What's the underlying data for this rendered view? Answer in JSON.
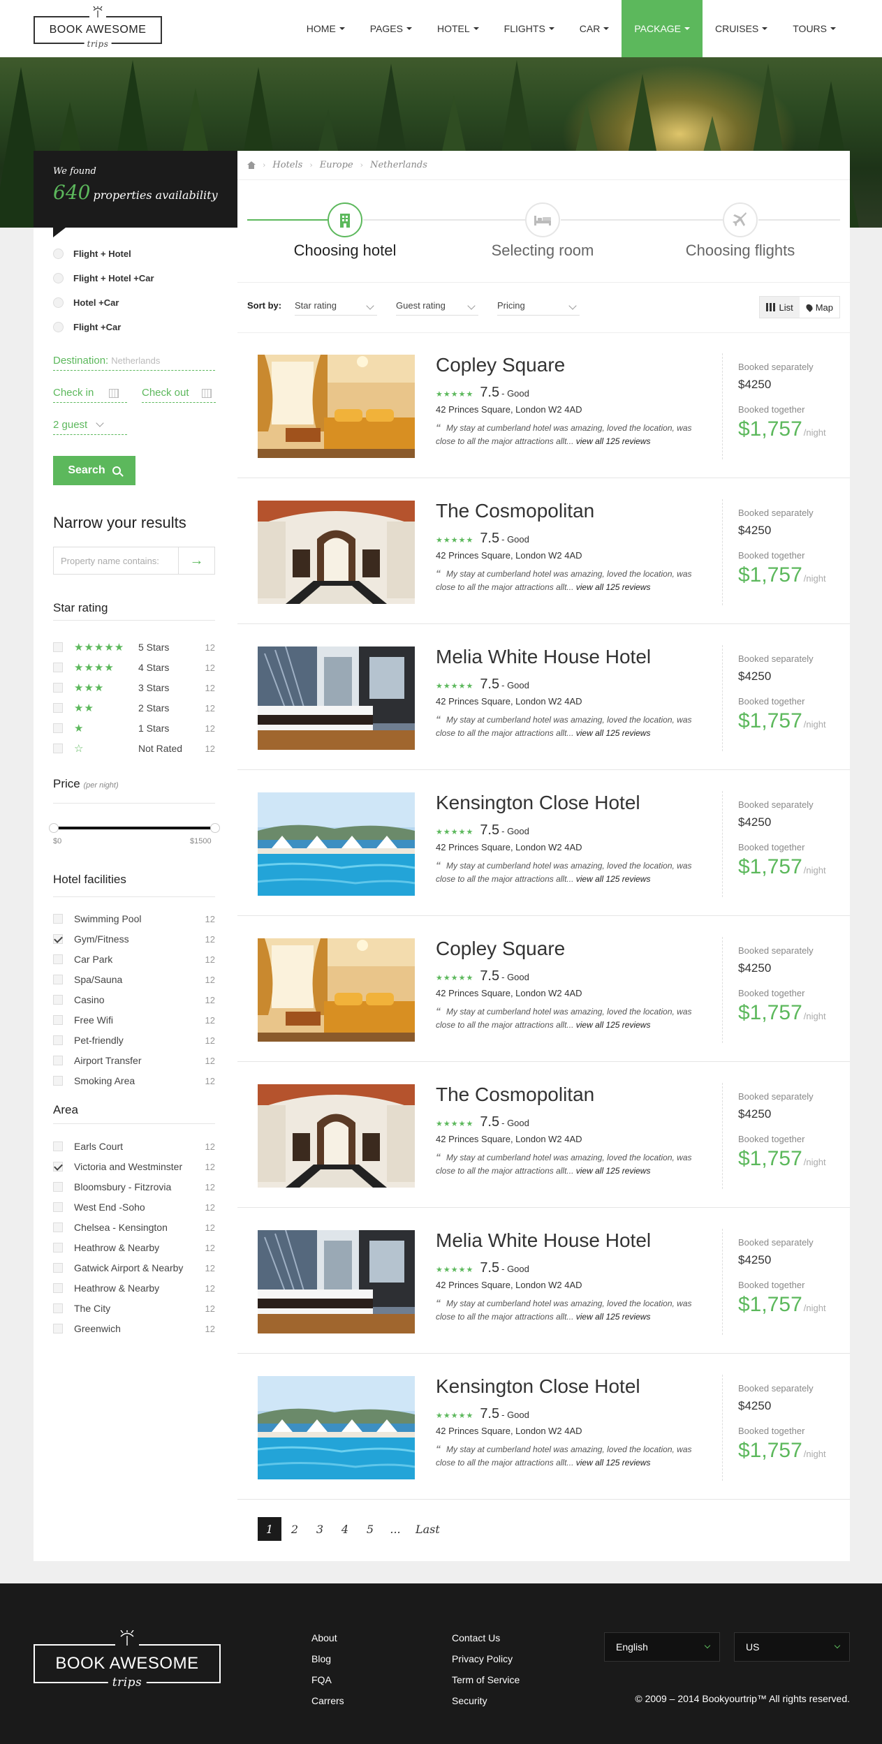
{
  "brand": {
    "logo_text": "BOOK AWESOME",
    "logo_script": "trips"
  },
  "nav": [
    {
      "label": "HOME",
      "active": false
    },
    {
      "label": "PAGES",
      "active": false
    },
    {
      "label": "HOTEL",
      "active": false
    },
    {
      "label": "FLIGHTS",
      "active": false
    },
    {
      "label": "CAR",
      "active": false
    },
    {
      "label": "PACKAGE",
      "active": true
    },
    {
      "label": "CRUISES",
      "active": false
    },
    {
      "label": "TOURS",
      "active": false
    }
  ],
  "colors": {
    "accent": "#5cb85c",
    "dark": "#1b1b1b"
  },
  "sidebar": {
    "found_label": "We found",
    "found_count": "640",
    "found_suffix": "properties availability",
    "trip_types": [
      "Flight + Hotel",
      "Flight + Hotel +Car",
      "Hotel +Car",
      "Flight +Car"
    ],
    "destination_label": "Destination:",
    "destination_placeholder": "Netherlands",
    "checkin_label": "Check in",
    "checkout_label": "Check out",
    "guests": "2 guest",
    "search_label": "Search",
    "narrow_title": "Narrow your results",
    "property_placeholder": "Property name contains:",
    "star_title": "Star rating",
    "stars": [
      {
        "stars": "★★★★★",
        "label": "5 Stars",
        "count": "12"
      },
      {
        "stars": "★★★★",
        "label": "4 Stars",
        "count": "12"
      },
      {
        "stars": "★★★",
        "label": "3 Stars",
        "count": "12"
      },
      {
        "stars": "★★",
        "label": "2 Stars",
        "count": "12"
      },
      {
        "stars": "★",
        "label": "1 Stars",
        "count": "12"
      },
      {
        "stars": "☆",
        "label": "Not Rated",
        "count": "12"
      }
    ],
    "price_title": "Price",
    "price_sub": "(per night)",
    "price_min": "$0",
    "price_max": "$1500",
    "facilities_title": "Hotel facilities",
    "facilities": [
      {
        "label": "Swimming Pool",
        "count": "12",
        "checked": false
      },
      {
        "label": "Gym/Fitness",
        "count": "12",
        "checked": true
      },
      {
        "label": "Car Park",
        "count": "12",
        "checked": false
      },
      {
        "label": "Spa/Sauna",
        "count": "12",
        "checked": false
      },
      {
        "label": "Casino",
        "count": "12",
        "checked": false
      },
      {
        "label": "Free Wifi",
        "count": "12",
        "checked": false
      },
      {
        "label": "Pet-friendly",
        "count": "12",
        "checked": false
      },
      {
        "label": "Airport Transfer",
        "count": "12",
        "checked": false
      },
      {
        "label": "Smoking Area",
        "count": "12",
        "checked": false
      }
    ],
    "area_title": "Area",
    "areas": [
      {
        "label": "Earls Court",
        "count": "12",
        "checked": false
      },
      {
        "label": "Victoria and Westminster",
        "count": "12",
        "checked": true
      },
      {
        "label": "Bloomsbury - Fitzrovia",
        "count": "12",
        "checked": false
      },
      {
        "label": "West End -Soho",
        "count": "12",
        "checked": false
      },
      {
        "label": "Chelsea - Kensington",
        "count": "12",
        "checked": false
      },
      {
        "label": "Heathrow & Nearby",
        "count": "12",
        "checked": false
      },
      {
        "label": "Gatwick Airport & Nearby",
        "count": "12",
        "checked": false
      },
      {
        "label": "Heathrow & Nearby",
        "count": "12",
        "checked": false
      },
      {
        "label": "The City",
        "count": "12",
        "checked": false
      },
      {
        "label": "Greenwich",
        "count": "12",
        "checked": false
      }
    ]
  },
  "breadcrumb": [
    "Hotels",
    "Europe",
    "Netherlands"
  ],
  "steps": [
    {
      "label": "Choosing hotel",
      "icon": "building-icon",
      "active": true
    },
    {
      "label": "Selecting room",
      "icon": "bed-icon",
      "active": false
    },
    {
      "label": "Choosing flights",
      "icon": "plane-icon",
      "active": false
    }
  ],
  "sort": {
    "label": "Sort by:",
    "options": [
      "Star rating",
      "Guest rating",
      "Pricing"
    ],
    "view_list": "List",
    "view_map": "Map"
  },
  "hotels": [
    {
      "name": "Copley Square",
      "stars": "★★★★★",
      "score": "7.5",
      "score_label": "- Good",
      "address": "42 Princes Square, London W2 4AD",
      "quote": "My stay at cumberland hotel was amazing, loved the location, was close to all the major attractions allt...",
      "reviews": "view all 125 reviews",
      "sep_label": "Booked separately",
      "sep_price": "$4250",
      "tog_label": "Booked together",
      "tog_price": "$1,757",
      "per": "/night",
      "image": "bedroom-gold"
    },
    {
      "name": "The Cosmopolitan",
      "stars": "★★★★★",
      "score": "7.5",
      "score_label": "- Good",
      "address": "42 Princes Square, London W2 4AD",
      "quote": "My stay at cumberland hotel was amazing, loved the location, was close to all the major attractions allt...",
      "reviews": "view all 125 reviews",
      "sep_label": "Booked separately",
      "sep_price": "$4250",
      "tog_label": "Booked together",
      "tog_price": "$1,757",
      "per": "/night",
      "image": "hallway-arch"
    },
    {
      "name": "Melia White House Hotel",
      "stars": "★★★★★",
      "score": "7.5",
      "score_label": "- Good",
      "address": "42 Princes Square, London W2 4AD",
      "quote": "My stay at cumberland hotel was amazing, loved the location, was close to all the major attractions allt...",
      "reviews": "view all 125 reviews",
      "sep_label": "Booked separately",
      "sep_price": "$4250",
      "tog_label": "Booked together",
      "tog_price": "$1,757",
      "per": "/night",
      "image": "bedroom-modern"
    },
    {
      "name": "Kensington Close Hotel",
      "stars": "★★★★★",
      "score": "7.5",
      "score_label": "- Good",
      "address": "42 Princes Square, London W2 4AD",
      "quote": "My stay at cumberland hotel was amazing, loved the location, was close to all the major attractions allt...",
      "reviews": "view all 125 reviews",
      "sep_label": "Booked separately",
      "sep_price": "$4250",
      "tog_label": "Booked together",
      "tog_price": "$1,757",
      "per": "/night",
      "image": "pool-sea"
    },
    {
      "name": "Copley Square",
      "stars": "★★★★★",
      "score": "7.5",
      "score_label": "- Good",
      "address": "42 Princes Square, London W2 4AD",
      "quote": "My stay at cumberland hotel was amazing, loved the location, was close to all the major attractions allt...",
      "reviews": "view all 125 reviews",
      "sep_label": "Booked separately",
      "sep_price": "$4250",
      "tog_label": "Booked together",
      "tog_price": "$1,757",
      "per": "/night",
      "image": "bedroom-gold"
    },
    {
      "name": "The Cosmopolitan",
      "stars": "★★★★★",
      "score": "7.5",
      "score_label": "- Good",
      "address": "42 Princes Square, London W2 4AD",
      "quote": "My stay at cumberland hotel was amazing, loved the location, was close to all the major attractions allt...",
      "reviews": "view all 125 reviews",
      "sep_label": "Booked separately",
      "sep_price": "$4250",
      "tog_label": "Booked together",
      "tog_price": "$1,757",
      "per": "/night",
      "image": "hallway-arch"
    },
    {
      "name": "Melia White House Hotel",
      "stars": "★★★★★",
      "score": "7.5",
      "score_label": "- Good",
      "address": "42 Princes Square, London W2 4AD",
      "quote": "My stay at cumberland hotel was amazing, loved the location, was close to all the major attractions allt...",
      "reviews": "view all 125 reviews",
      "sep_label": "Booked separately",
      "sep_price": "$4250",
      "tog_label": "Booked together",
      "tog_price": "$1,757",
      "per": "/night",
      "image": "bedroom-modern"
    },
    {
      "name": "Kensington Close Hotel",
      "stars": "★★★★★",
      "score": "7.5",
      "score_label": "- Good",
      "address": "42 Princes Square, London W2 4AD",
      "quote": "My stay at cumberland hotel was amazing, loved the location, was close to all the major attractions allt...",
      "reviews": "view all 125 reviews",
      "sep_label": "Booked separately",
      "sep_price": "$4250",
      "tog_label": "Booked together",
      "tog_price": "$1,757",
      "per": "/night",
      "image": "pool-sea"
    }
  ],
  "pagination": {
    "pages": [
      "1",
      "2",
      "3",
      "4",
      "5",
      "..."
    ],
    "current": "1",
    "last": "Last"
  },
  "footer": {
    "col1": [
      "About",
      "Blog",
      "FQA",
      "Carrers"
    ],
    "col2": [
      "Contact Us",
      "Privacy Policy",
      "Term of Service",
      "Security"
    ],
    "language": "English",
    "region": "US",
    "copyright": "© 2009 – 2014 Bookyourtrip™ All rights reserved."
  }
}
